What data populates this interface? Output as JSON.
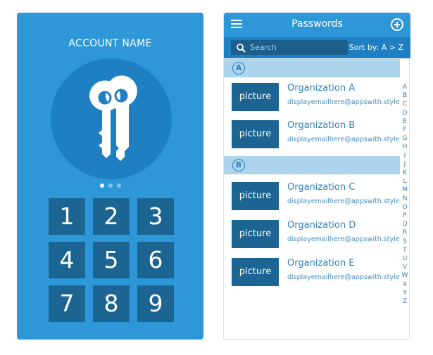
{
  "lock_screen": {
    "account_name": "ACCOUNT NAME",
    "dots": [
      true,
      false,
      false
    ],
    "keys": [
      "1",
      "2",
      "3",
      "4",
      "5",
      "6",
      "7",
      "8",
      "9"
    ],
    "colors": {
      "background": "#2e97d8",
      "circle": "#1e80c2",
      "key": "#1c6592"
    }
  },
  "passwords": {
    "title": "Passwords",
    "search_placeholder": "Search",
    "sort_label": "Sort by: A > Z",
    "sections": [
      {
        "letter": "A",
        "items": [
          {
            "picture": "picture",
            "name": "Organization A",
            "email": "displayemailhere@appswith.style"
          },
          {
            "picture": "picture",
            "name": "Organization B",
            "email": "displayemailhere@appswith.style"
          }
        ]
      },
      {
        "letter": "B",
        "items": [
          {
            "picture": "picture",
            "name": "Organization C",
            "email": "displayemailhere@appswith.style"
          },
          {
            "picture": "picture",
            "name": "Organization D",
            "email": "displayemailhere@appswith.style"
          },
          {
            "picture": "picture",
            "name": "Organization E",
            "email": "displayemailhere@appswith.style"
          }
        ]
      }
    ],
    "alphabet_index": [
      "A",
      "B",
      "C",
      "D",
      "E",
      "F",
      "G",
      "H",
      "I",
      "J",
      "K",
      "L",
      "M",
      "N",
      "O",
      "P",
      "Q",
      "R",
      "S",
      "T",
      "U",
      "V",
      "W",
      "X",
      "Y",
      "Z"
    ],
    "icons": {
      "menu": "menu-icon",
      "add": "add-circle-icon",
      "search": "search-icon",
      "lock": "keys-icon"
    },
    "colors": {
      "appbar": "#2e97d8",
      "searchbar": "#1e80c2",
      "section": "#acd4ea",
      "text": "#2e7fc0"
    }
  }
}
